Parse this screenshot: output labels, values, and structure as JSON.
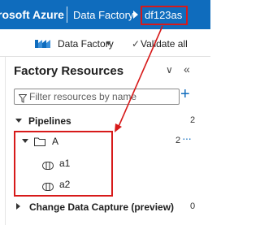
{
  "header": {
    "app_title": "rosoft Azure",
    "breadcrumb": [
      "Data Factory",
      "df123as"
    ]
  },
  "toolbar": {
    "factory_label": "Data Factory",
    "validate_label": "Validate all"
  },
  "panel": {
    "title": "Factory Resources",
    "filter_placeholder": "Filter resources by name",
    "sections": [
      {
        "label": "Pipelines",
        "count": "2",
        "folders": [
          {
            "label": "A",
            "count": "2",
            "items": [
              "a1",
              "a2"
            ]
          }
        ]
      },
      {
        "label": "Change Data Capture (preview)",
        "count": "0"
      }
    ]
  },
  "colors": {
    "header_blue": "#0f6cbd",
    "highlight_red": "#d71a1a",
    "accent_blue": "#0f6cbd"
  },
  "icons": [
    "data-factory-icon",
    "checkmark-icon",
    "chevron-down-icon",
    "collapse-all-icon",
    "double-chevron-left-icon",
    "filter-icon",
    "add-icon",
    "folder-icon",
    "pipeline-icon",
    "more-options-icon"
  ]
}
